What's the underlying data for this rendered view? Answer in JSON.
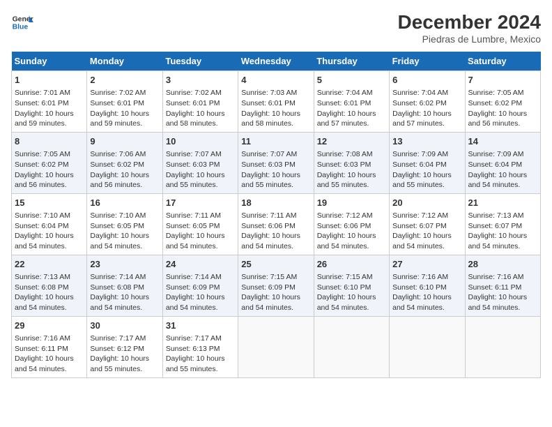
{
  "logo": {
    "line1": "General",
    "line2": "Blue"
  },
  "title": "December 2024",
  "subtitle": "Piedras de Lumbre, Mexico",
  "days_of_week": [
    "Sunday",
    "Monday",
    "Tuesday",
    "Wednesday",
    "Thursday",
    "Friday",
    "Saturday"
  ],
  "weeks": [
    [
      {
        "day": "1",
        "info": "Sunrise: 7:01 AM\nSunset: 6:01 PM\nDaylight: 10 hours\nand 59 minutes."
      },
      {
        "day": "2",
        "info": "Sunrise: 7:02 AM\nSunset: 6:01 PM\nDaylight: 10 hours\nand 59 minutes."
      },
      {
        "day": "3",
        "info": "Sunrise: 7:02 AM\nSunset: 6:01 PM\nDaylight: 10 hours\nand 58 minutes."
      },
      {
        "day": "4",
        "info": "Sunrise: 7:03 AM\nSunset: 6:01 PM\nDaylight: 10 hours\nand 58 minutes."
      },
      {
        "day": "5",
        "info": "Sunrise: 7:04 AM\nSunset: 6:01 PM\nDaylight: 10 hours\nand 57 minutes."
      },
      {
        "day": "6",
        "info": "Sunrise: 7:04 AM\nSunset: 6:02 PM\nDaylight: 10 hours\nand 57 minutes."
      },
      {
        "day": "7",
        "info": "Sunrise: 7:05 AM\nSunset: 6:02 PM\nDaylight: 10 hours\nand 56 minutes."
      }
    ],
    [
      {
        "day": "8",
        "info": "Sunrise: 7:05 AM\nSunset: 6:02 PM\nDaylight: 10 hours\nand 56 minutes."
      },
      {
        "day": "9",
        "info": "Sunrise: 7:06 AM\nSunset: 6:02 PM\nDaylight: 10 hours\nand 56 minutes."
      },
      {
        "day": "10",
        "info": "Sunrise: 7:07 AM\nSunset: 6:03 PM\nDaylight: 10 hours\nand 55 minutes."
      },
      {
        "day": "11",
        "info": "Sunrise: 7:07 AM\nSunset: 6:03 PM\nDaylight: 10 hours\nand 55 minutes."
      },
      {
        "day": "12",
        "info": "Sunrise: 7:08 AM\nSunset: 6:03 PM\nDaylight: 10 hours\nand 55 minutes."
      },
      {
        "day": "13",
        "info": "Sunrise: 7:09 AM\nSunset: 6:04 PM\nDaylight: 10 hours\nand 55 minutes."
      },
      {
        "day": "14",
        "info": "Sunrise: 7:09 AM\nSunset: 6:04 PM\nDaylight: 10 hours\nand 54 minutes."
      }
    ],
    [
      {
        "day": "15",
        "info": "Sunrise: 7:10 AM\nSunset: 6:04 PM\nDaylight: 10 hours\nand 54 minutes."
      },
      {
        "day": "16",
        "info": "Sunrise: 7:10 AM\nSunset: 6:05 PM\nDaylight: 10 hours\nand 54 minutes."
      },
      {
        "day": "17",
        "info": "Sunrise: 7:11 AM\nSunset: 6:05 PM\nDaylight: 10 hours\nand 54 minutes."
      },
      {
        "day": "18",
        "info": "Sunrise: 7:11 AM\nSunset: 6:06 PM\nDaylight: 10 hours\nand 54 minutes."
      },
      {
        "day": "19",
        "info": "Sunrise: 7:12 AM\nSunset: 6:06 PM\nDaylight: 10 hours\nand 54 minutes."
      },
      {
        "day": "20",
        "info": "Sunrise: 7:12 AM\nSunset: 6:07 PM\nDaylight: 10 hours\nand 54 minutes."
      },
      {
        "day": "21",
        "info": "Sunrise: 7:13 AM\nSunset: 6:07 PM\nDaylight: 10 hours\nand 54 minutes."
      }
    ],
    [
      {
        "day": "22",
        "info": "Sunrise: 7:13 AM\nSunset: 6:08 PM\nDaylight: 10 hours\nand 54 minutes."
      },
      {
        "day": "23",
        "info": "Sunrise: 7:14 AM\nSunset: 6:08 PM\nDaylight: 10 hours\nand 54 minutes."
      },
      {
        "day": "24",
        "info": "Sunrise: 7:14 AM\nSunset: 6:09 PM\nDaylight: 10 hours\nand 54 minutes."
      },
      {
        "day": "25",
        "info": "Sunrise: 7:15 AM\nSunset: 6:09 PM\nDaylight: 10 hours\nand 54 minutes."
      },
      {
        "day": "26",
        "info": "Sunrise: 7:15 AM\nSunset: 6:10 PM\nDaylight: 10 hours\nand 54 minutes."
      },
      {
        "day": "27",
        "info": "Sunrise: 7:16 AM\nSunset: 6:10 PM\nDaylight: 10 hours\nand 54 minutes."
      },
      {
        "day": "28",
        "info": "Sunrise: 7:16 AM\nSunset: 6:11 PM\nDaylight: 10 hours\nand 54 minutes."
      }
    ],
    [
      {
        "day": "29",
        "info": "Sunrise: 7:16 AM\nSunset: 6:11 PM\nDaylight: 10 hours\nand 54 minutes."
      },
      {
        "day": "30",
        "info": "Sunrise: 7:17 AM\nSunset: 6:12 PM\nDaylight: 10 hours\nand 55 minutes."
      },
      {
        "day": "31",
        "info": "Sunrise: 7:17 AM\nSunset: 6:13 PM\nDaylight: 10 hours\nand 55 minutes."
      },
      {
        "day": "",
        "info": ""
      },
      {
        "day": "",
        "info": ""
      },
      {
        "day": "",
        "info": ""
      },
      {
        "day": "",
        "info": ""
      }
    ]
  ]
}
